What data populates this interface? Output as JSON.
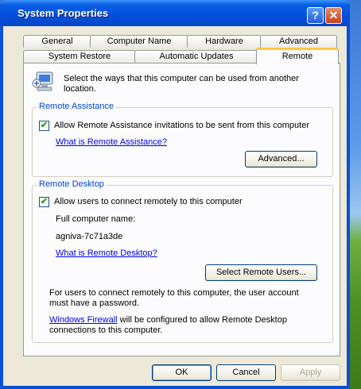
{
  "window": {
    "title": "System Properties",
    "help_glyph": "?",
    "close_glyph": "✕"
  },
  "tabs": {
    "row1": [
      "General",
      "Computer Name",
      "Hardware",
      "Advanced"
    ],
    "row2": [
      "System Restore",
      "Automatic Updates",
      "Remote"
    ],
    "active": "Remote"
  },
  "intro": {
    "icon": "remote-computer-icon",
    "text": "Select the ways that this computer can be used from another location."
  },
  "remote_assistance": {
    "group_label": "Remote Assistance",
    "checkbox_label": "Allow Remote Assistance invitations to be sent from this computer",
    "checked": true,
    "help_link": "What is Remote Assistance?",
    "advanced_button": "Advanced..."
  },
  "remote_desktop": {
    "group_label": "Remote Desktop",
    "checkbox_label": "Allow users to connect remotely to this computer",
    "checked": true,
    "computer_name_label": "Full computer name:",
    "computer_name": "agniva-7c71a3de",
    "help_link": "What is Remote Desktop?",
    "select_users_button": "Select Remote Users...",
    "password_note": "For users to connect remotely to this computer, the user account must have a password.",
    "firewall_link": "Windows Firewall",
    "firewall_note": " will be configured to allow Remote Desktop connections to this computer."
  },
  "footer": {
    "ok": "OK",
    "cancel": "Cancel",
    "apply": "Apply"
  },
  "colors": {
    "title_bar": "#0550dd",
    "dialog_bg": "#ece9d8",
    "tab_highlight": "#ffc83c",
    "group_label": "#0046d5",
    "link": "#0000ee"
  }
}
